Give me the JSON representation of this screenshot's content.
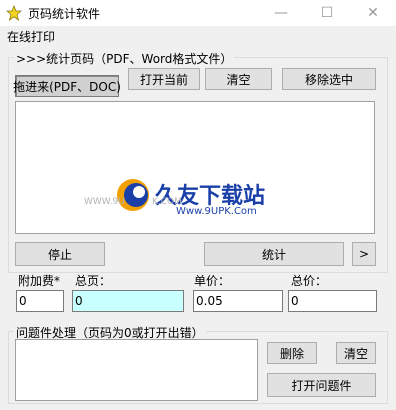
{
  "window": {
    "title": "页码统计软件",
    "minimize_glyph": "—",
    "maximize_glyph": "☐",
    "close_glyph": "✕"
  },
  "menu": {
    "items": [
      "在线打印"
    ]
  },
  "stats_group": {
    "label": ">>>统计页码（PDF、Word格式文件）",
    "drag_label": "拖进来(PDF、DOC)",
    "open_current_label": "打开当前",
    "clear_label": "清空",
    "remove_selected_label": "移除选中"
  },
  "watermark": {
    "brand": "久友下载站",
    "url_left": "WWW.9U",
    "url_right": "K.COM",
    "url_sub": "Www.9UPK.Com"
  },
  "actions": {
    "stop_label": "停止",
    "count_label": "统计",
    "more_label": ">"
  },
  "fields": {
    "surcharge_label": "附加费*",
    "total_pages_label": "总页：",
    "unit_price_label": "单价：",
    "total_price_label": "总价：",
    "surcharge_value": "0",
    "total_pages_value": "0",
    "unit_price_value": "0.05",
    "total_price_value": "0"
  },
  "problem_group": {
    "label": "问题件处理（页码为0或打开出错）",
    "delete_label": "删除",
    "clear_label": "清空",
    "open_label": "打开问题件"
  },
  "colors": {
    "cyan_field": "#c8ffff",
    "brand_blue": "#1a3fa8",
    "brand_orange": "#f08a00"
  }
}
